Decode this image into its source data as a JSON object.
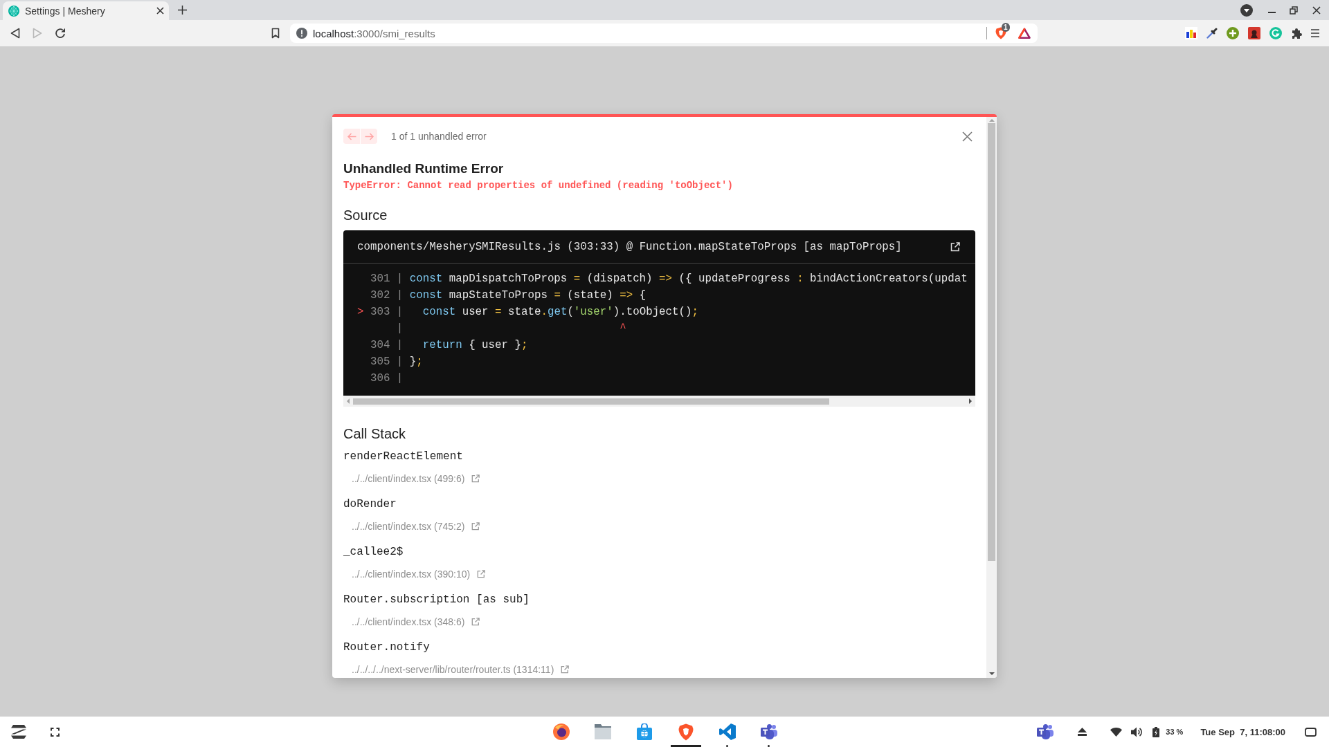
{
  "browser": {
    "tabs": [
      {
        "title": "Settings | Meshery",
        "selected": true
      }
    ],
    "nav_buttons": [
      {
        "kind": "back",
        "disabled": false
      },
      {
        "kind": "forward",
        "disabled": true
      },
      {
        "kind": "reload",
        "disabled": false
      }
    ],
    "address": {
      "host": "localhost",
      "path": ":3000/smi_results"
    },
    "shield_badge": "1"
  },
  "dialog": {
    "nav_buttons": [
      {
        "kind": "previous",
        "disabled": true
      },
      {
        "kind": "next",
        "disabled": true
      }
    ],
    "counter": "1 of 1 unhandled error",
    "title": "Unhandled Runtime Error",
    "message": "TypeError: Cannot read properties of undefined (reading 'toObject')",
    "source": {
      "heading": "Source",
      "file": "components/MesherySMIResults.js (303:33) @ Function.mapStateToProps [as mapToProps]",
      "lines": [
        {
          "kind": "code",
          "gutter": "301 |",
          "tokens": [
            {
              "kind": "keyword",
              "text": "const"
            },
            {
              "kind": "plain",
              "text": " mapDispatchToProps "
            },
            {
              "kind": "punct",
              "text": "="
            },
            {
              "kind": "plain",
              "text": " (dispatch) "
            },
            {
              "kind": "punct",
              "text": "=>"
            },
            {
              "kind": "plain",
              "text": " ({ updateProgress "
            },
            {
              "kind": "punct",
              "text": ":"
            },
            {
              "kind": "plain",
              "text": " bindActionCreators(updat"
            }
          ]
        },
        {
          "kind": "code",
          "gutter": "302 |",
          "tokens": [
            {
              "kind": "keyword",
              "text": "const"
            },
            {
              "kind": "plain",
              "text": " mapStateToProps "
            },
            {
              "kind": "punct",
              "text": "="
            },
            {
              "kind": "plain",
              "text": " (state) "
            },
            {
              "kind": "punct",
              "text": "=>"
            },
            {
              "kind": "plain",
              "text": " {"
            }
          ]
        },
        {
          "kind": "code",
          "marker": ">",
          "gutter": "303 |",
          "tokens": [
            {
              "kind": "keyword",
              "text": "  const"
            },
            {
              "kind": "plain",
              "text": " user "
            },
            {
              "kind": "punct",
              "text": "="
            },
            {
              "kind": "plain",
              "text": " state"
            },
            {
              "kind": "punct",
              "text": "."
            },
            {
              "kind": "method",
              "text": "get"
            },
            {
              "kind": "plain",
              "text": "("
            },
            {
              "kind": "string",
              "text": "'user'"
            },
            {
              "kind": "plain",
              "text": ").toObject()"
            },
            {
              "kind": "punct",
              "text": ";"
            }
          ]
        },
        {
          "kind": "caret",
          "gutter": "|",
          "caret": "                                ^"
        },
        {
          "kind": "code",
          "gutter": "304 |",
          "tokens": [
            {
              "kind": "keyword",
              "text": "  return"
            },
            {
              "kind": "plain",
              "text": " { user }"
            },
            {
              "kind": "punct",
              "text": ";"
            }
          ]
        },
        {
          "kind": "code",
          "gutter": "305 |",
          "tokens": [
            {
              "kind": "plain",
              "text": "}"
            },
            {
              "kind": "punct",
              "text": ";"
            }
          ]
        },
        {
          "kind": "code",
          "gutter": "306 |"
        }
      ]
    },
    "call_stack": {
      "heading": "Call Stack",
      "frames": [
        {
          "function": "renderReactElement",
          "location": "../../client/index.tsx (499:6)"
        },
        {
          "function": "doRender",
          "location": "../../client/index.tsx (745:2)"
        },
        {
          "function": "_callee2$",
          "location": "../../client/index.tsx (390:10)"
        },
        {
          "function": "Router.subscription [as sub]",
          "location": "../../client/index.tsx (348:6)"
        },
        {
          "function": "Router.notify",
          "location": "../../../../next-server/lib/router/router.ts (1314:11)"
        }
      ]
    }
  },
  "taskbar": {
    "apps": [
      {
        "kind": "fox",
        "active": false,
        "running": false
      },
      {
        "kind": "folder",
        "active": false,
        "running": false
      },
      {
        "kind": "store",
        "active": false,
        "running": false
      },
      {
        "kind": "shield",
        "active": true,
        "running": false
      },
      {
        "kind": "editor",
        "active": false,
        "running": true
      },
      {
        "kind": "chat",
        "active": false,
        "running": true
      }
    ],
    "battery": "33 %",
    "clock": "Tue Sep  7, 11:08:00"
  }
}
